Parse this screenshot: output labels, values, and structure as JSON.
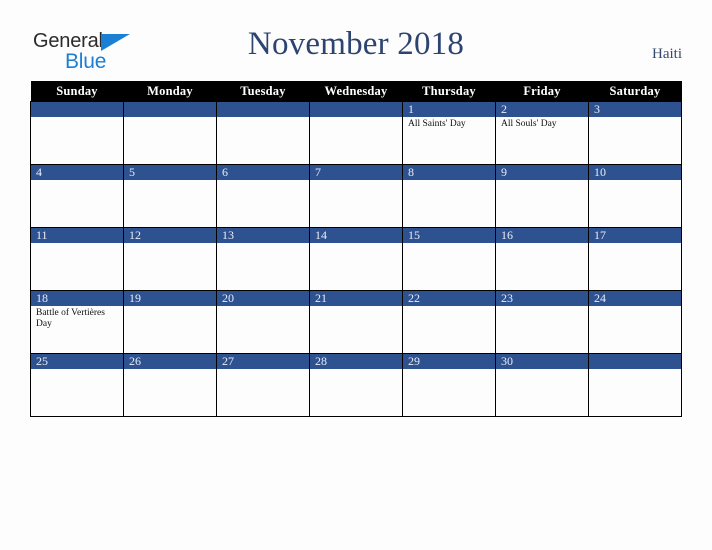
{
  "brand": {
    "name_part1": "General",
    "name_part2": "Blue",
    "triangle_icon": "triangle-right-icon",
    "accent_color": "#1b7fd4"
  },
  "header": {
    "title": "November 2018",
    "country": "Haiti",
    "title_color": "#2e4470"
  },
  "calendar": {
    "banner_color": "#2e5290",
    "header_bg": "#000000",
    "weekday_headers": [
      "Sunday",
      "Monday",
      "Tuesday",
      "Wednesday",
      "Thursday",
      "Friday",
      "Saturday"
    ],
    "weeks": [
      [
        {
          "day": "",
          "event": ""
        },
        {
          "day": "",
          "event": ""
        },
        {
          "day": "",
          "event": ""
        },
        {
          "day": "",
          "event": ""
        },
        {
          "day": "1",
          "event": "All Saints' Day"
        },
        {
          "day": "2",
          "event": "All Souls' Day"
        },
        {
          "day": "3",
          "event": ""
        }
      ],
      [
        {
          "day": "4",
          "event": ""
        },
        {
          "day": "5",
          "event": ""
        },
        {
          "day": "6",
          "event": ""
        },
        {
          "day": "7",
          "event": ""
        },
        {
          "day": "8",
          "event": ""
        },
        {
          "day": "9",
          "event": ""
        },
        {
          "day": "10",
          "event": ""
        }
      ],
      [
        {
          "day": "11",
          "event": ""
        },
        {
          "day": "12",
          "event": ""
        },
        {
          "day": "13",
          "event": ""
        },
        {
          "day": "14",
          "event": ""
        },
        {
          "day": "15",
          "event": ""
        },
        {
          "day": "16",
          "event": ""
        },
        {
          "day": "17",
          "event": ""
        }
      ],
      [
        {
          "day": "18",
          "event": "Battle of Vertières Day"
        },
        {
          "day": "19",
          "event": ""
        },
        {
          "day": "20",
          "event": ""
        },
        {
          "day": "21",
          "event": ""
        },
        {
          "day": "22",
          "event": ""
        },
        {
          "day": "23",
          "event": ""
        },
        {
          "day": "24",
          "event": ""
        }
      ],
      [
        {
          "day": "25",
          "event": ""
        },
        {
          "day": "26",
          "event": ""
        },
        {
          "day": "27",
          "event": ""
        },
        {
          "day": "28",
          "event": ""
        },
        {
          "day": "29",
          "event": ""
        },
        {
          "day": "30",
          "event": ""
        },
        {
          "day": "",
          "event": ""
        }
      ]
    ]
  }
}
